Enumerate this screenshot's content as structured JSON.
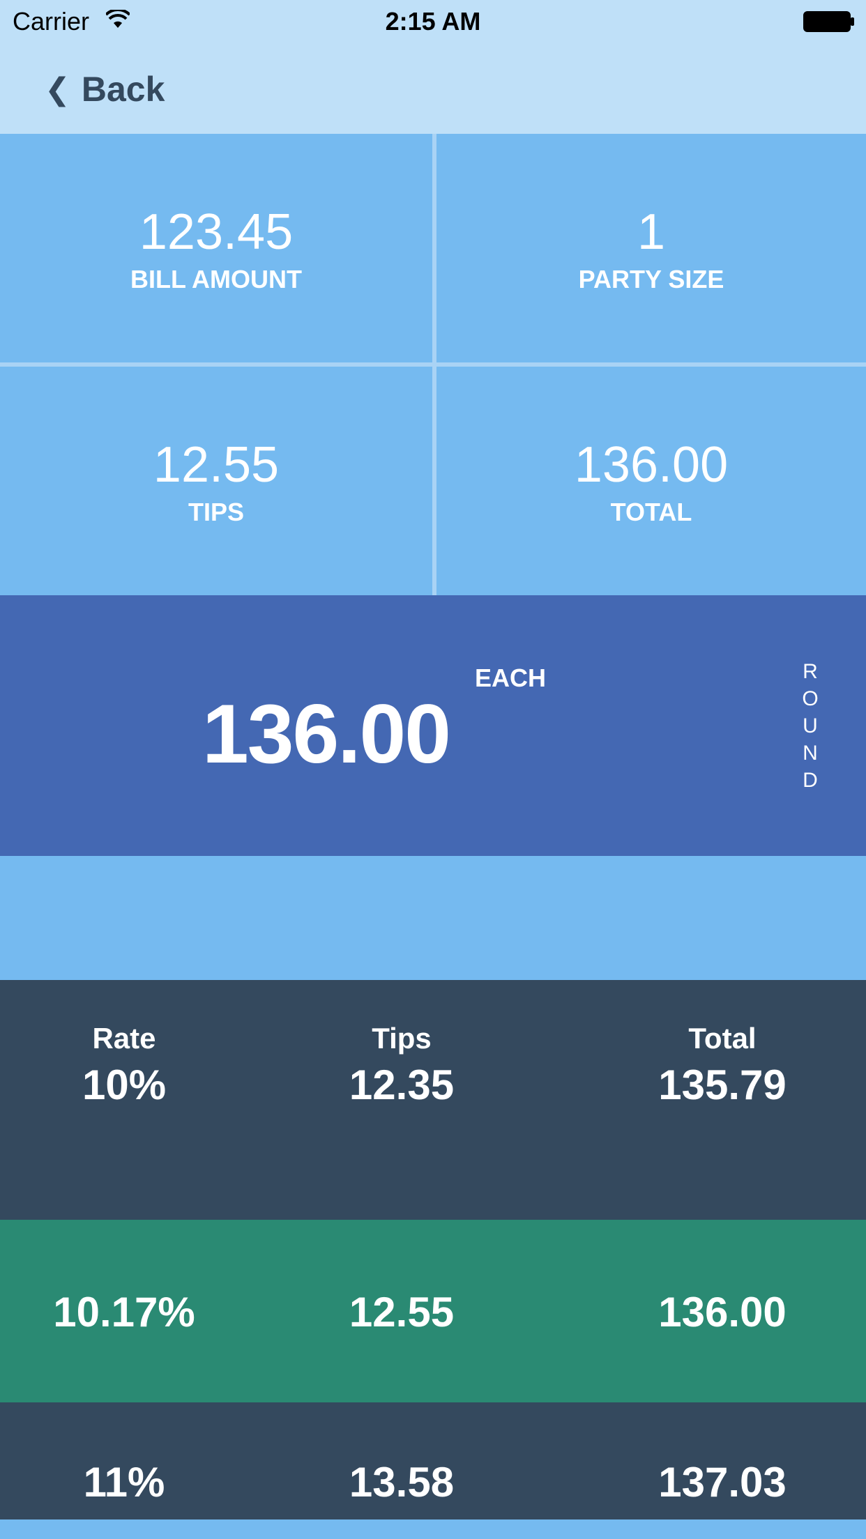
{
  "status_bar": {
    "carrier": "Carrier",
    "time": "2:15 AM"
  },
  "nav": {
    "back_label": "Back"
  },
  "grid": {
    "bill_amount": {
      "value": "123.45",
      "label": "BILL AMOUNT"
    },
    "party_size": {
      "value": "1",
      "label": "PARTY SIZE"
    },
    "tips": {
      "value": "12.55",
      "label": "TIPS"
    },
    "total": {
      "value": "136.00",
      "label": "TOTAL"
    }
  },
  "each": {
    "amount": "136.00",
    "label": "EACH",
    "round_letters": [
      "R",
      "O",
      "U",
      "N",
      "D"
    ]
  },
  "table": {
    "headers": {
      "rate": "Rate",
      "tips": "Tips",
      "total": "Total"
    },
    "rows": [
      {
        "rate": "10%",
        "tips": "12.35",
        "total": "135.79"
      },
      {
        "rate": "10.17%",
        "tips": "12.55",
        "total": "136.00"
      },
      {
        "rate": "11%",
        "tips": "13.58",
        "total": "137.03"
      }
    ]
  },
  "colors": {
    "light_blue": "#75baf0",
    "nav_bg": "#bfe0f8",
    "each_band": "#4468b3",
    "table_bg": "#34495e",
    "selected_row": "#2a8a73"
  }
}
